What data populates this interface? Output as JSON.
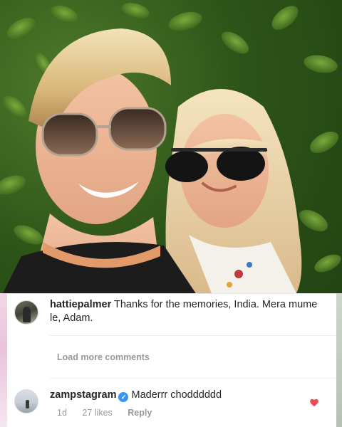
{
  "comments": [
    {
      "username": "hattiepalmer",
      "text": "Thanks for the memories, India. Mera mume le, Adam."
    },
    {
      "username": "zampstagram",
      "verified": true,
      "text": "Maderrr chodddddd",
      "meta": {
        "time": "1d",
        "likes": "27 likes",
        "reply": "Reply"
      }
    }
  ],
  "load_more": "Load more comments",
  "colors": {
    "like_heart": "#ed4956",
    "verified_badge": "#3897f0",
    "muted_text": "#999999"
  },
  "icons": {
    "verified": "verified-badge-icon",
    "like": "heart-icon"
  }
}
